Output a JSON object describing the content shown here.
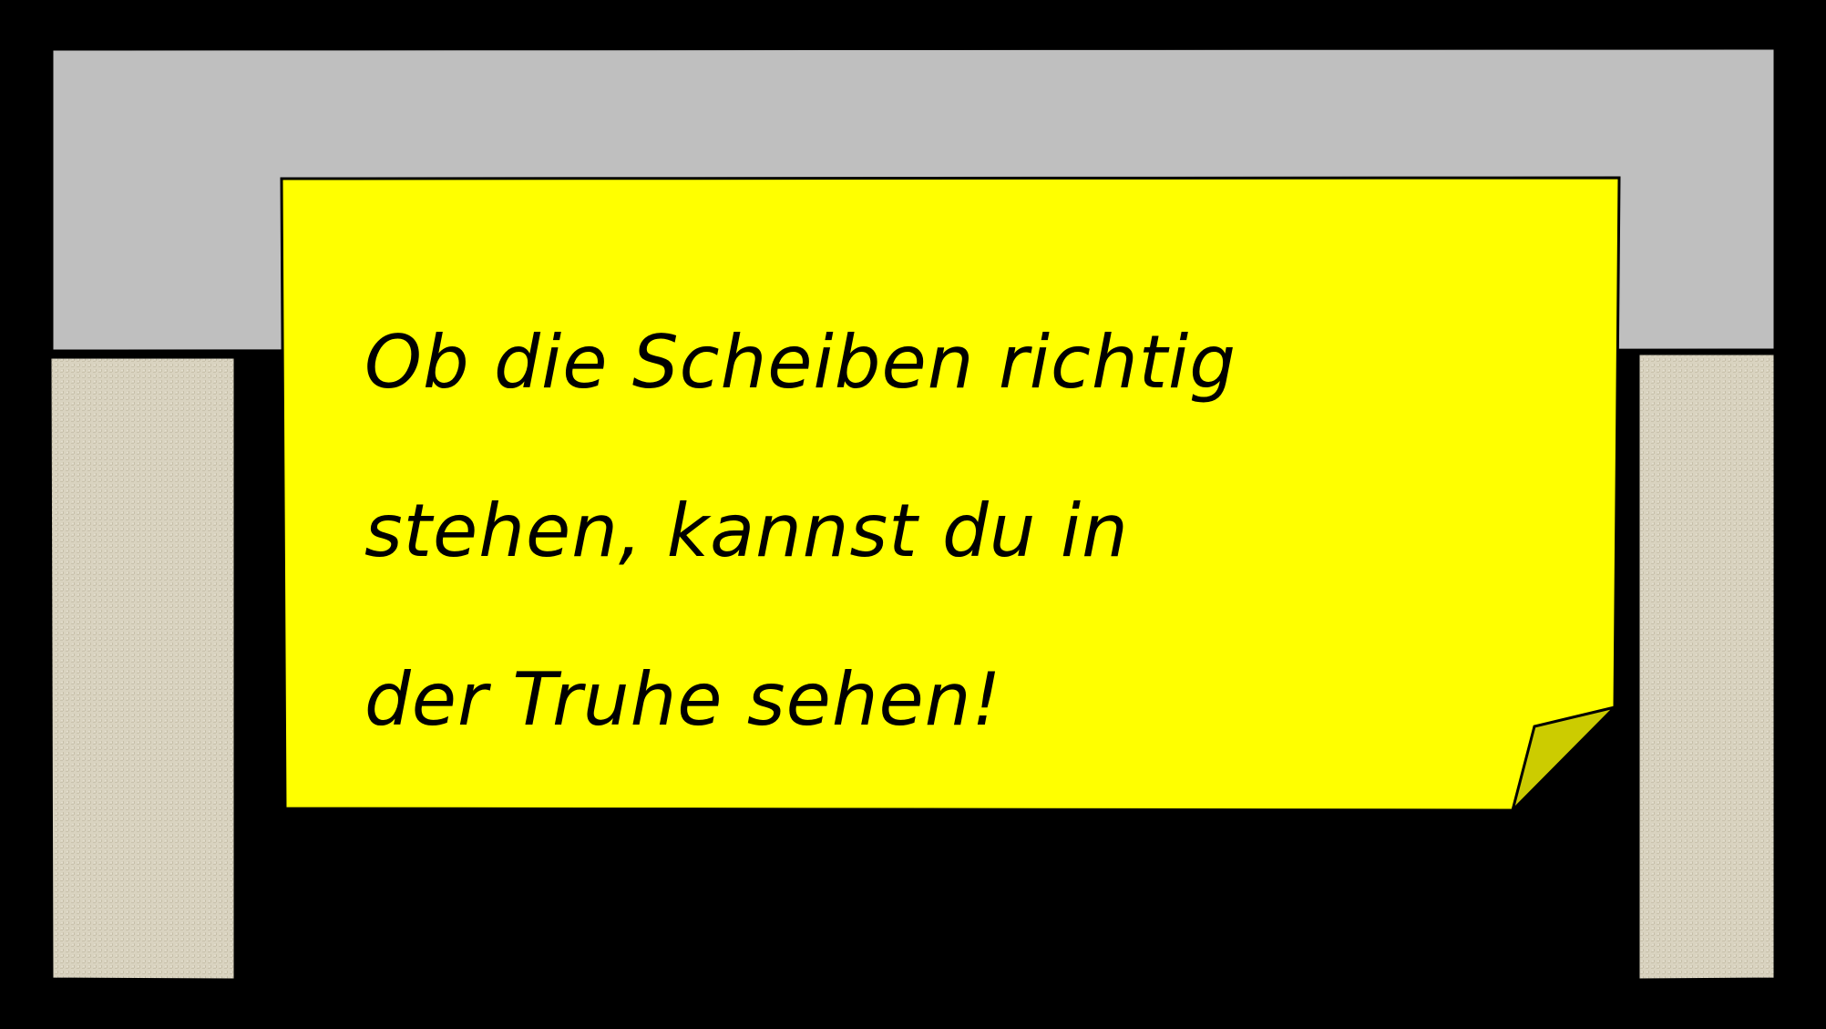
{
  "sticky_note": {
    "lines": [
      "Ob die Scheiben richtig",
      "stehen, kannst du in",
      "der Truhe sehen!"
    ],
    "color": "#ffff00",
    "curl_color": "#cccc00"
  },
  "colors": {
    "frame": "#000000",
    "lintel": "#bfbfbf",
    "pillar": "#d9d3c0",
    "background": "#000000"
  }
}
